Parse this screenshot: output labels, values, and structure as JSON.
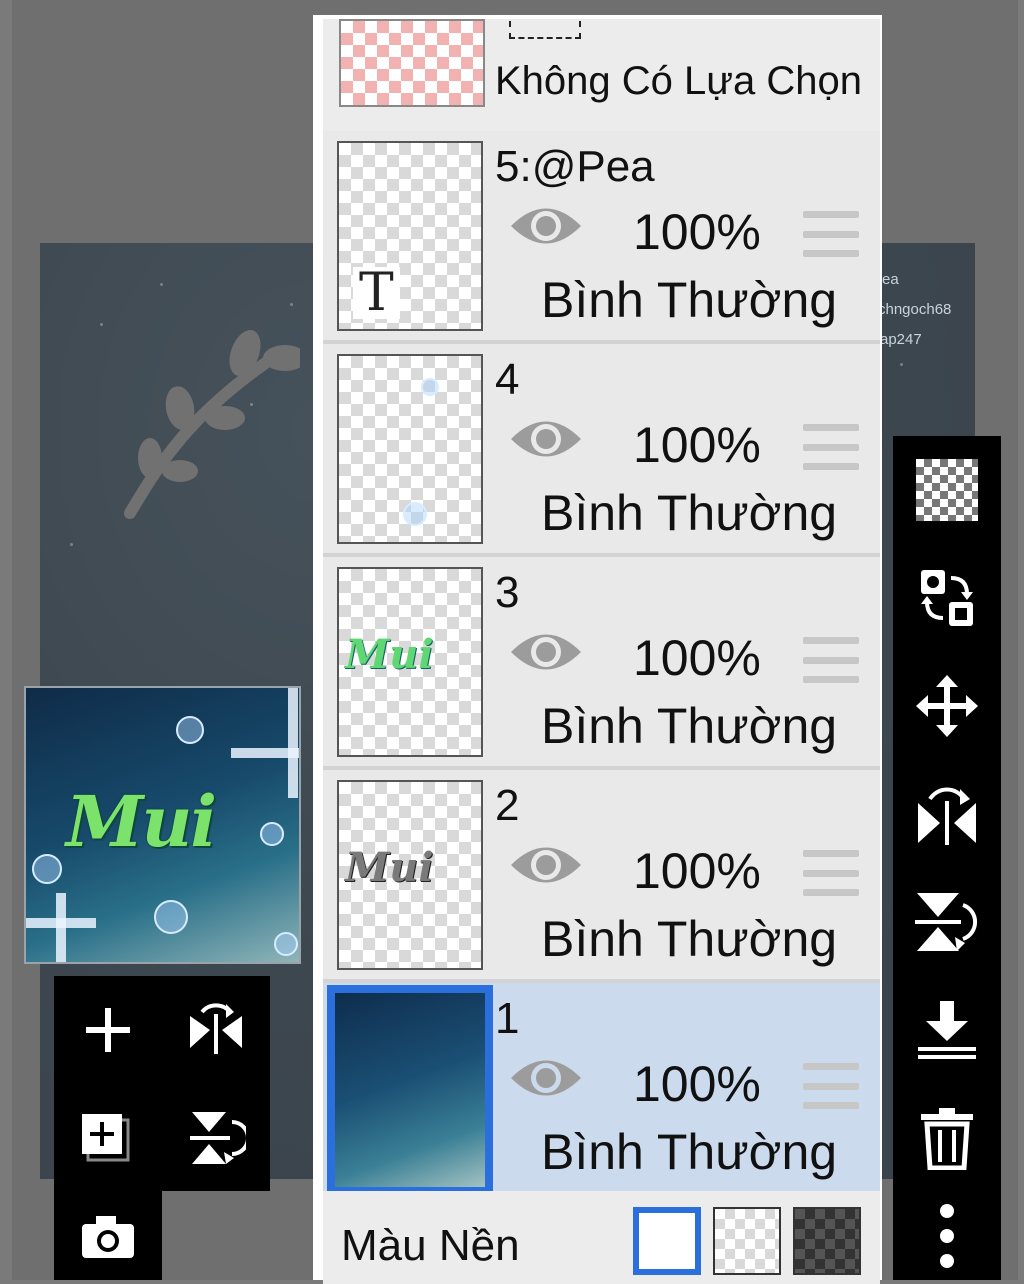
{
  "artwork_credits": [
    "ea",
    "chngoch68",
    "ap247"
  ],
  "selection_row": {
    "label": "Không Có Lựa Chọn"
  },
  "layers": [
    {
      "name": "5:@Pea",
      "opacity": "100%",
      "blend_mode": "Bình Thường",
      "thumb_glyph": "T",
      "visible": true
    },
    {
      "name": "4",
      "opacity": "100%",
      "blend_mode": "Bình Thường",
      "visible": true
    },
    {
      "name": "3",
      "opacity": "100%",
      "blend_mode": "Bình Thường",
      "visible": true
    },
    {
      "name": "2",
      "opacity": "100%",
      "blend_mode": "Bình Thường",
      "visible": true
    },
    {
      "name": "1",
      "opacity": "100%",
      "blend_mode": "Bình Thường",
      "visible": true,
      "selected": true
    }
  ],
  "footer": {
    "label": "Màu Nền",
    "options": [
      "white",
      "transparent",
      "dark-checker"
    ],
    "selected": "white"
  },
  "right_toolbar": [
    "transparency-icon",
    "swap-layer-icon",
    "move-icon",
    "flip-horizontal-icon",
    "flip-vertical-icon",
    "merge-down-icon",
    "trash-icon",
    "more-icon"
  ],
  "left_toolbar": [
    "add-layer-icon",
    "flip-horizontal-rotate-icon",
    "add-copy-layer-icon",
    "flip-vertical-rotate-icon",
    "camera-icon"
  ],
  "preview": {
    "text": "Mui"
  },
  "colors": {
    "selected_row": "#ccdaee",
    "accent_blue": "#2a6fdc",
    "toolbar_bg": "#000000"
  }
}
